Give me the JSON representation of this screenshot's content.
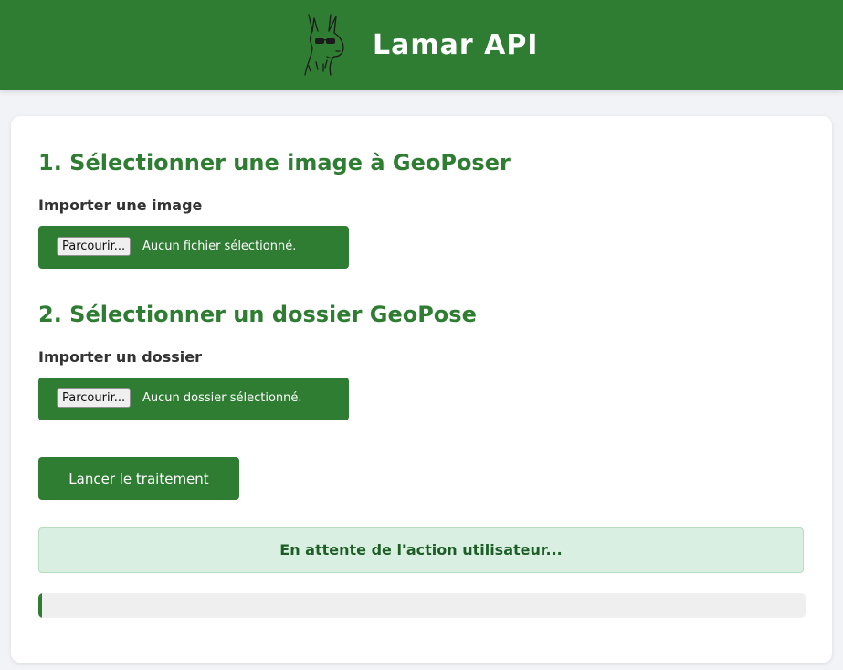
{
  "header": {
    "title": "Lamar API",
    "logo_icon": "llama-with-sunglasses-icon"
  },
  "colors": {
    "primary": "#2e7d32",
    "status_bg": "#d9efe1",
    "status_text": "#1d5e26",
    "page_bg": "#f2f3f7"
  },
  "section1": {
    "title": "1. Sélectionner une image à GeoPoser",
    "label": "Importer une image",
    "browse_label": "Parcourir...",
    "status": "Aucun fichier sélectionné."
  },
  "section2": {
    "title": "2. Sélectionner un dossier GeoPose",
    "label": "Importer un dossier",
    "browse_label": "Parcourir...",
    "status": "Aucun dossier sélectionné."
  },
  "run_button": {
    "label": "Lancer le traitement"
  },
  "status_message": "En attente de l'action utilisateur...",
  "progress": {
    "percent": 0.5
  }
}
